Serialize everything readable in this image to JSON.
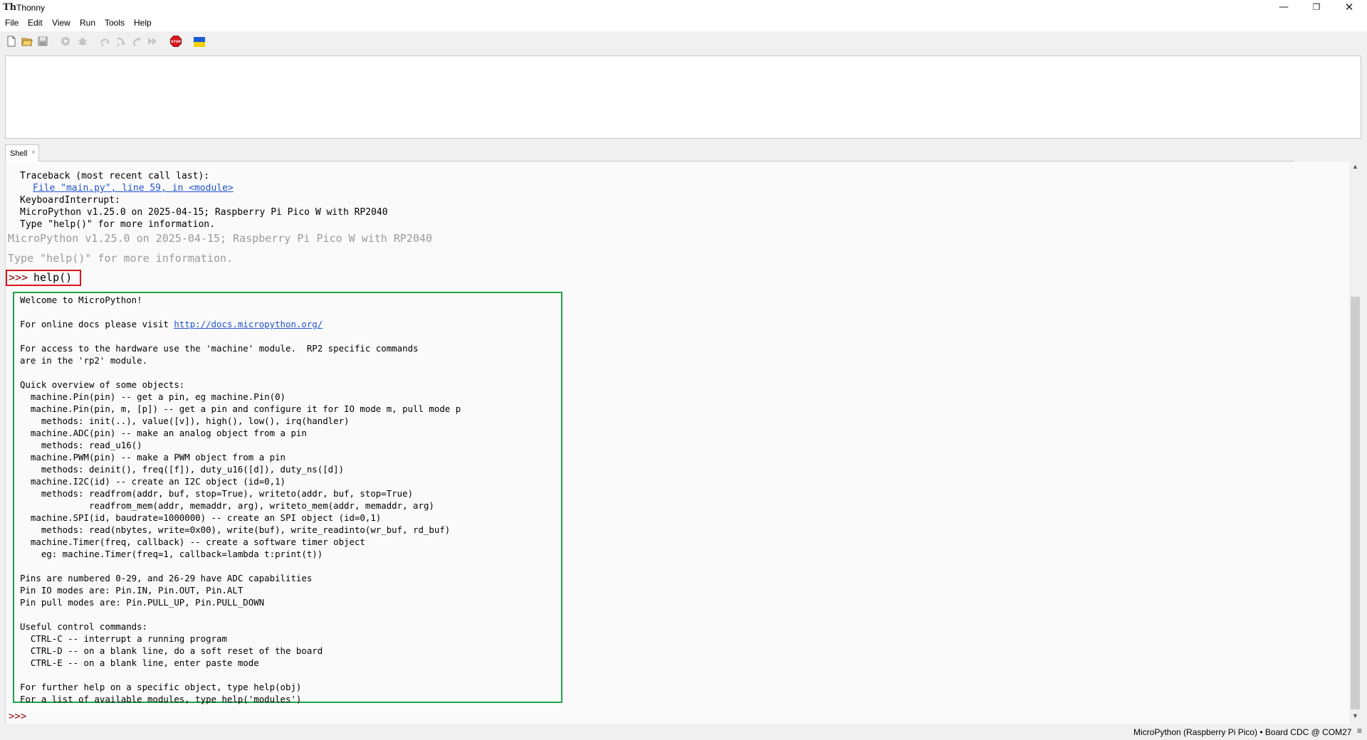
{
  "window": {
    "title": "Thonny",
    "app_icon_glyph": "Th",
    "minimize": "—",
    "maximize": "❐",
    "close": "✕"
  },
  "menu": [
    "File",
    "Edit",
    "View",
    "Run",
    "Tools",
    "Help"
  ],
  "toolbar": {
    "icons": [
      "new-file-icon",
      "open-file-icon",
      "save-icon",
      "run-icon",
      "debug-icon",
      "step-over-icon",
      "step-into-icon",
      "step-out-icon",
      "resume-icon",
      "stop-icon",
      "ukraine-flag-icon"
    ],
    "stop_label": "STOP",
    "stop_color": "#d9141c"
  },
  "shell_tab": {
    "label": "Shell",
    "close": "×"
  },
  "shell": {
    "traceback": "Traceback (most recent call last):",
    "file_link": "File \"main.py\", line 59, in <module>",
    "keyboard_interrupt": "KeyboardInterrupt:",
    "version_line": "MicroPython v1.25.0 on 2025-04-15; Raspberry Pi Pico W with RP2040",
    "type_help_line": "Type \"help()\" for more information.",
    "gray_version": "MicroPython v1.25.0 on 2025-04-15; Raspberry Pi Pico W with RP2040",
    "gray_type_help": "Type \"help()\" for more information.",
    "prompt": ">>>",
    "command": "help()",
    "help_lines": [
      "Welcome to MicroPython!",
      "",
      "For online docs please visit http://docs.micropython.org/",
      "",
      "For access to the hardware use the 'machine' module.  RP2 specific commands",
      "are in the 'rp2' module.",
      "",
      "Quick overview of some objects:",
      "  machine.Pin(pin) -- get a pin, eg machine.Pin(0)",
      "  machine.Pin(pin, m, [p]) -- get a pin and configure it for IO mode m, pull mode p",
      "    methods: init(..), value([v]), high(), low(), irq(handler)",
      "  machine.ADC(pin) -- make an analog object from a pin",
      "    methods: read_u16()",
      "  machine.PWM(pin) -- make a PWM object from a pin",
      "    methods: deinit(), freq([f]), duty_u16([d]), duty_ns([d])",
      "  machine.I2C(id) -- create an I2C object (id=0,1)",
      "    methods: readfrom(addr, buf, stop=True), writeto(addr, buf, stop=True)",
      "             readfrom_mem(addr, memaddr, arg), writeto_mem(addr, memaddr, arg)",
      "  machine.SPI(id, baudrate=1000000) -- create an SPI object (id=0,1)",
      "    methods: read(nbytes, write=0x00), write(buf), write_readinto(wr_buf, rd_buf)",
      "  machine.Timer(freq, callback) -- create a software timer object",
      "    eg: machine.Timer(freq=1, callback=lambda t:print(t))",
      "",
      "Pins are numbered 0-29, and 26-29 have ADC capabilities",
      "Pin IO modes are: Pin.IN, Pin.OUT, Pin.ALT",
      "Pin pull modes are: Pin.PULL_UP, Pin.PULL_DOWN",
      "",
      "Useful control commands:",
      "  CTRL-C -- interrupt a running program",
      "  CTRL-D -- on a blank line, do a soft reset of the board",
      "  CTRL-E -- on a blank line, enter paste mode",
      "",
      "For further help on a specific object, type help(obj)",
      "For a list of available modules, type help('modules')"
    ],
    "help_link_text": "http://docs.micropython.org/",
    "final_prompt": ">>>",
    "highlight_command_color": "#d9141c",
    "highlight_output_color": "#1fa34a"
  },
  "statusbar": {
    "text": "MicroPython (Raspberry Pi Pico)  •  Board CDC @ COM27",
    "menu_glyph": "≡"
  }
}
